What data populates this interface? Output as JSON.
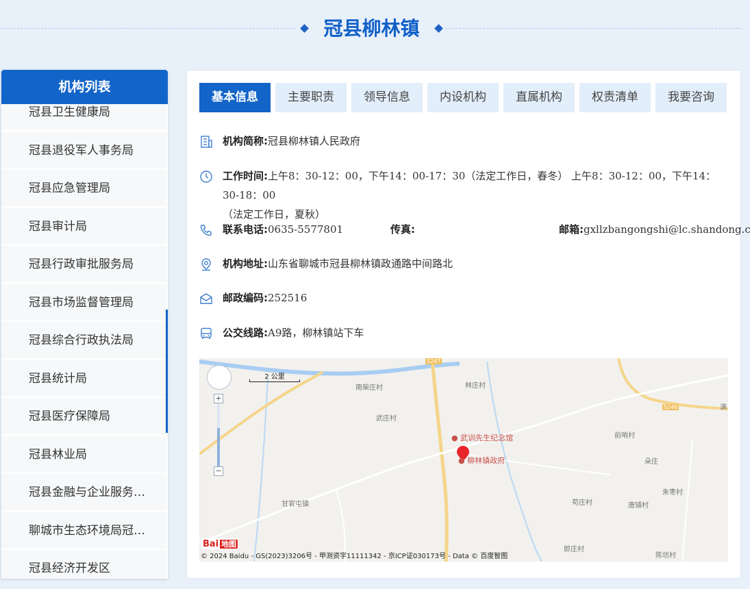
{
  "header": {
    "title": "冠县柳林镇"
  },
  "sidebar": {
    "title": "机构列表",
    "items": [
      "冠县卫生健康局",
      "冠县退役军人事务局",
      "冠县应急管理局",
      "冠县审计局",
      "冠县行政审批服务局",
      "冠县市场监督管理局",
      "冠县综合行政执法局",
      "冠县统计局",
      "冠县医疗保障局",
      "冠县林业局",
      "冠县金融与企业服务中心",
      "聊城市生态环境局冠县分局",
      "冠县经济开发区"
    ]
  },
  "tabs": [
    "基本信息",
    "主要职责",
    "领导信息",
    "内设机构",
    "直属机构",
    "权责清单",
    "我要咨询"
  ],
  "info": {
    "short_name_label": "机构简称:",
    "short_name": "冠县柳林镇人民政府",
    "hours_label": "工作时间:",
    "hours_line1": "上午8：30-12：00，下午14：00-17：30（法定工作日，春冬） 上午8：30-12：00，下午14：30-18：00",
    "hours_line2": "（法定工作日，夏秋）",
    "phone_label": "联系电话:",
    "phone": "0635-5577801",
    "fax_label": "传真:",
    "fax": "",
    "email_label": "邮箱:",
    "email": "gxllzbangongshi@lc.shandong.cn",
    "address_label": "机构地址:",
    "address": "山东省聊城市冠县柳林镇政通路中间路北",
    "postcode_label": "邮政编码:",
    "postcode": "252516",
    "bus_label": "公交线路:",
    "bus": "A9路，柳林镇站下车"
  },
  "map": {
    "scale": "2 公里",
    "zoom_in": "+",
    "zoom_out": "−",
    "labels": {
      "nancz": "南柴庄村",
      "linz": "林庄村",
      "wuz": "武庄村",
      "qianmeng": "前哨村",
      "duozhuang": "朵庄",
      "zhuzao": "朱枣村",
      "gouzhuang": "苟庄村",
      "tangpu": "唐铺村",
      "ganguan": "甘官屯镇",
      "zhengzhuang": "郎庄村",
      "chenfang": "陈坊村",
      "road_s247": "S247",
      "road_s246": "S246",
      "edge": "满"
    },
    "poi_memorial": "武训先生纪念馆",
    "poi_gov": "柳林镇政府",
    "logo": "Bai",
    "logo_sub": "地图",
    "copyright": "© 2024 Baidu - GS(2023)3206号 - 甲测资字11111342 - 京ICP证030173号 - Data © 百度智图"
  }
}
